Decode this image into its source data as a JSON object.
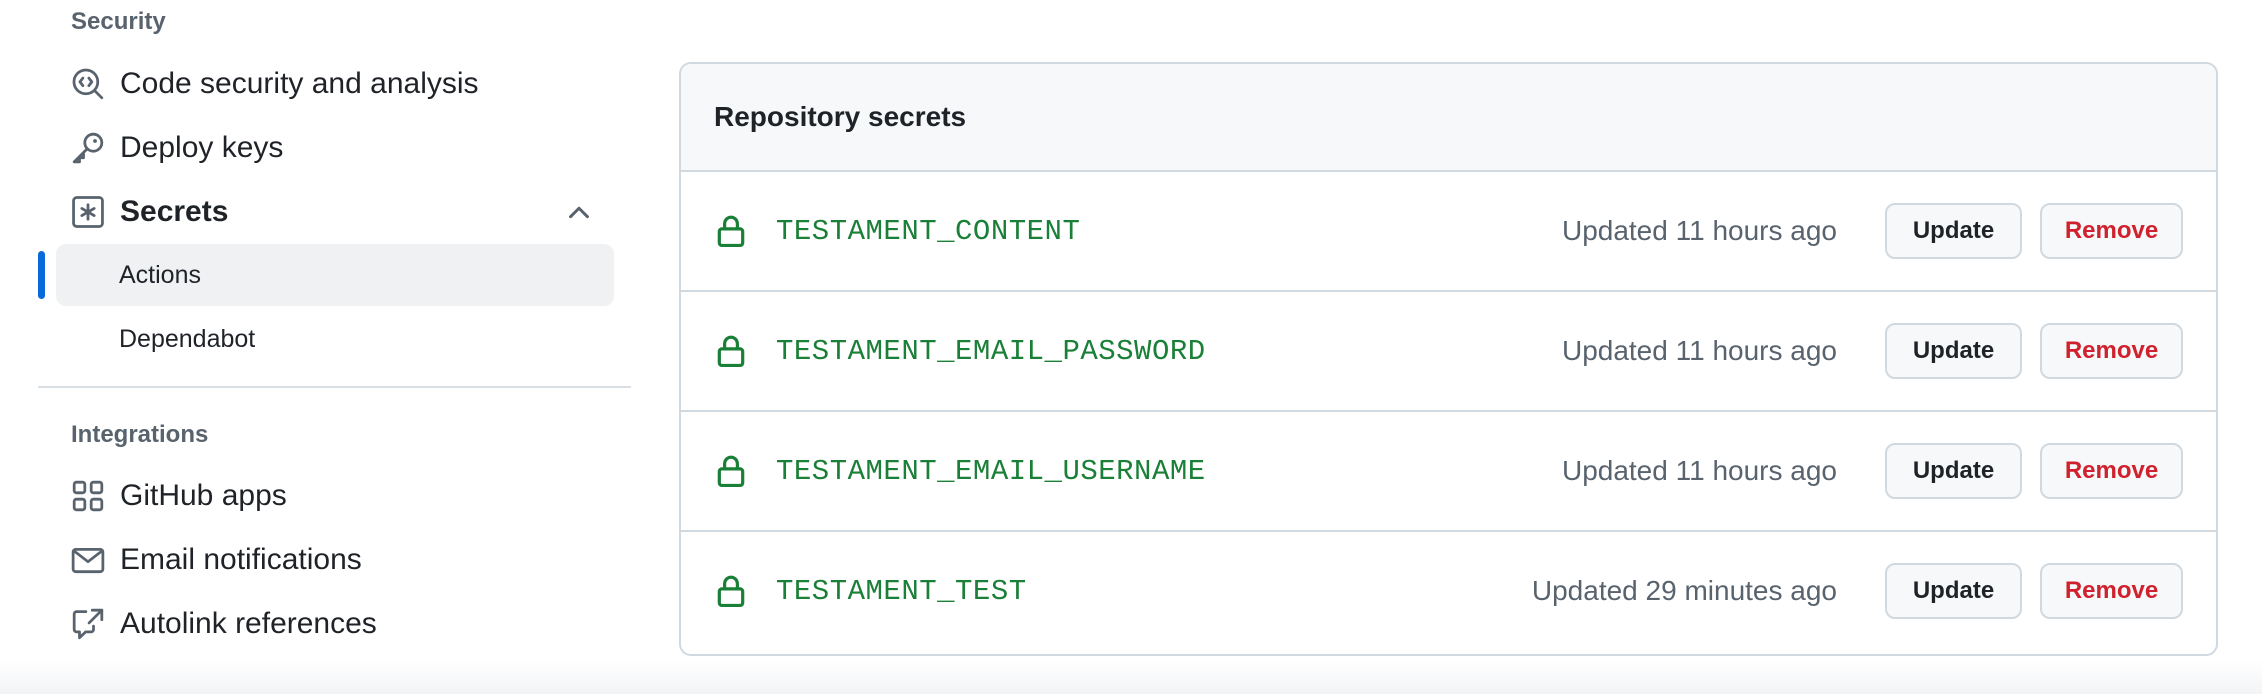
{
  "sidebar": {
    "security_heading": "Security",
    "integrations_heading": "Integrations",
    "items": [
      {
        "label": "Code security and analysis",
        "icon": "codescan-icon"
      },
      {
        "label": "Deploy keys",
        "icon": "key-icon"
      },
      {
        "label": "Secrets",
        "icon": "asterisk-icon",
        "expanded": true
      },
      {
        "label": "GitHub apps",
        "icon": "apps-icon"
      },
      {
        "label": "Email notifications",
        "icon": "mail-icon"
      },
      {
        "label": "Autolink references",
        "icon": "cross-reference-icon"
      }
    ],
    "secrets_sub": [
      {
        "label": "Actions",
        "selected": true
      },
      {
        "label": "Dependabot",
        "selected": false
      }
    ]
  },
  "panel": {
    "title": "Repository secrets",
    "update_label": "Update",
    "remove_label": "Remove",
    "secrets": [
      {
        "name": "TESTAMENT_CONTENT",
        "updated": "Updated 11 hours ago"
      },
      {
        "name": "TESTAMENT_EMAIL_PASSWORD",
        "updated": "Updated 11 hours ago"
      },
      {
        "name": "TESTAMENT_EMAIL_USERNAME",
        "updated": "Updated 11 hours ago"
      },
      {
        "name": "TESTAMENT_TEST",
        "updated": "Updated 29 minutes ago"
      }
    ]
  },
  "colors": {
    "accent": "#0969da",
    "secret_name": "#1a7f37",
    "danger": "#cf222e"
  }
}
